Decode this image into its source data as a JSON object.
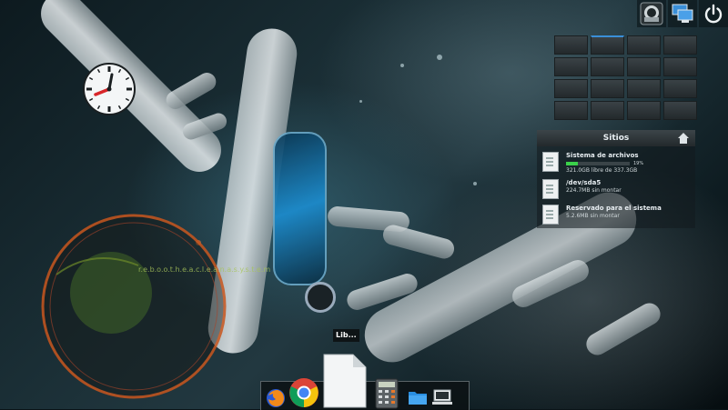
{
  "desktop": {
    "wallpaper_icon": "dna-helix-wallpaper"
  },
  "tray": {
    "icons": [
      "user-avatar-icon",
      "network-monitor-icon",
      "power-icon"
    ]
  },
  "workspaces": {
    "count": 16,
    "active_index": 1
  },
  "clock": {
    "icon": "analog-clock-icon",
    "hour_hand_hour": 8,
    "minute_hand_minutes": 13
  },
  "system_widget": {
    "label": "r.e.b.o.o.t.h.e.a.c.l.e.a.n.a.s.y.s.t.e.m"
  },
  "places": {
    "title": "Sitios",
    "items": [
      {
        "title": "Sistema de archivos",
        "usage_percent": "19%",
        "usage_fraction": 0.19,
        "subtitle": "321.0GB libre de 337.3GB"
      },
      {
        "title": "/dev/sda5",
        "subtitle": "224.7MB sin montar"
      },
      {
        "title": "Reservado para el sistema",
        "subtitle": "5.2.6MB sin montar"
      }
    ]
  },
  "launcher": {
    "tooltip": "Lib..."
  },
  "dock": {
    "items": [
      {
        "name": "firefox",
        "icon": "firefox-icon"
      },
      {
        "name": "chrome",
        "icon": "chrome-icon"
      },
      {
        "name": "libreoffice",
        "icon": "libreoffice-document-icon"
      },
      {
        "name": "calculator",
        "icon": "calculator-icon"
      },
      {
        "name": "files",
        "icon": "folder-icon"
      },
      {
        "name": "computer",
        "icon": "computer-icon"
      }
    ]
  }
}
